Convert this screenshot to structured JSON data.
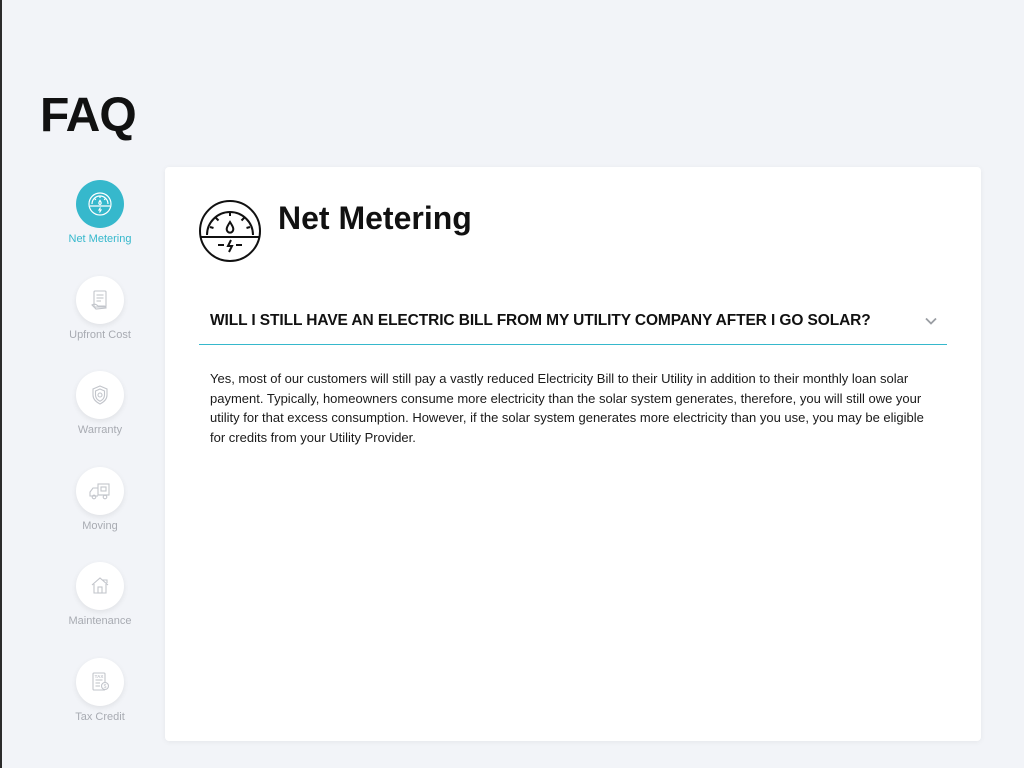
{
  "page": {
    "title": "FAQ"
  },
  "sidebar": {
    "items": [
      {
        "label": "Net Metering",
        "icon": "gauge-icon",
        "active": true
      },
      {
        "label": "Upfront Cost",
        "icon": "document-icon",
        "active": false
      },
      {
        "label": "Warranty",
        "icon": "shield-icon",
        "active": false
      },
      {
        "label": "Moving",
        "icon": "truck-icon",
        "active": false
      },
      {
        "label": "Maintenance",
        "icon": "house-icon",
        "active": false
      },
      {
        "label": "Tax Credit",
        "icon": "tax-document-icon",
        "active": false
      }
    ]
  },
  "section": {
    "title": "Net Metering",
    "icon": "gauge-icon"
  },
  "faq": {
    "question": "WILL I STILL HAVE AN ELECTRIC BILL FROM MY UTILITY COMPANY AFTER I GO SOLAR?",
    "answer": "Yes, most of our customers will still pay a vastly reduced Electricity Bill to their Utility in addition to their monthly loan solar payment. Typically, homeowners consume more electricity than the solar system generates, therefore, you will still owe your utility for that excess consumption. However, if the solar system generates more electricity than you use, you may be eligible for credits from your Utility Provider."
  },
  "colors": {
    "accent": "#36b8cc",
    "background": "#f2f4f8",
    "inactive": "#a8abb2"
  }
}
